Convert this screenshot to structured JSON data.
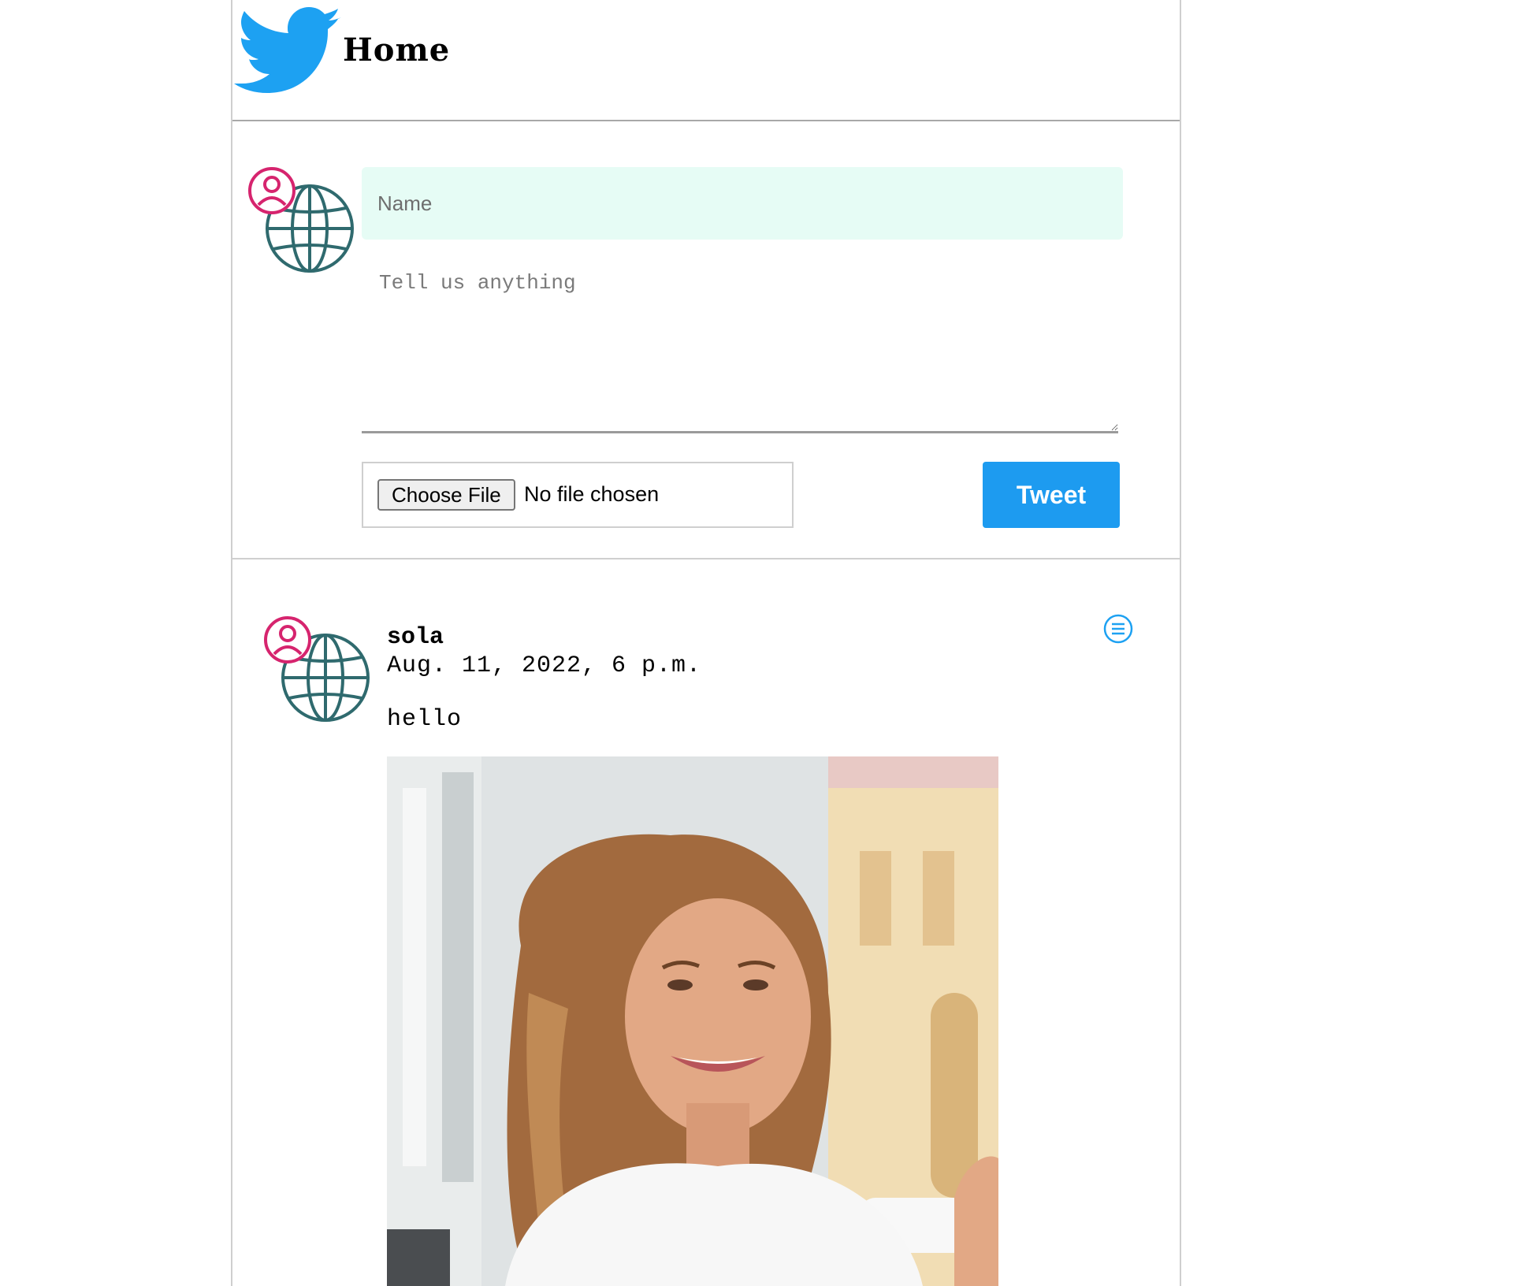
{
  "header": {
    "title": "Home",
    "logo_icon": "twitter-bird-icon"
  },
  "composer": {
    "name_placeholder": "Name",
    "message_placeholder": "Tell us anything",
    "choose_file_label": "Choose File",
    "file_status": "No file chosen",
    "tweet_label": "Tweet"
  },
  "posts": [
    {
      "author": "sola",
      "date": "Aug. 11, 2022, 6 p.m.",
      "text": "hello",
      "menu_icon": "menu-circle-icon",
      "image": "photo of smiling woman with long wavy hair on a city street"
    }
  ],
  "colors": {
    "brand": "#1d9bf0",
    "logo": "#1da1f2",
    "name_field_bg": "#e6fcf5",
    "avatar_user": "#d6246e",
    "avatar_globe": "#2f6a6e"
  }
}
